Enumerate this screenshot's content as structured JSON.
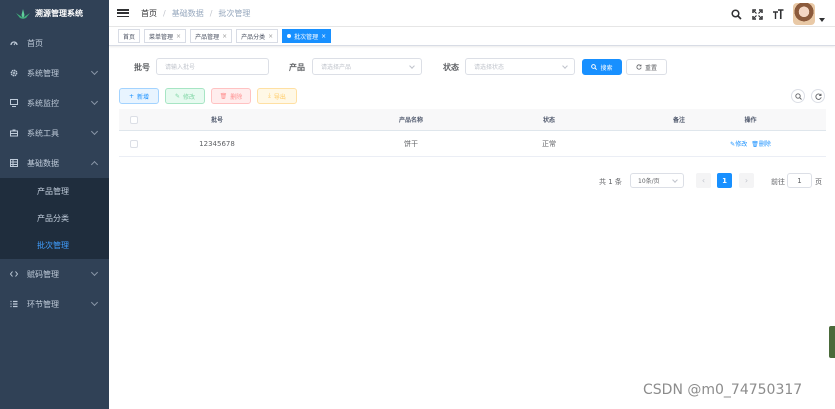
{
  "app": {
    "title": "溯源管理系统"
  },
  "sidebar": {
    "items": [
      {
        "label": "首页",
        "icon": "dashboard-icon"
      },
      {
        "label": "系统管理",
        "icon": "gear-icon"
      },
      {
        "label": "系统监控",
        "icon": "monitor-icon"
      },
      {
        "label": "系统工具",
        "icon": "toolbox-icon"
      },
      {
        "label": "基础数据",
        "icon": "table-icon"
      },
      {
        "label": "赋码管理",
        "icon": "code-icon"
      },
      {
        "label": "环节管理",
        "icon": "list-icon"
      }
    ],
    "submenu": [
      "产品管理",
      "产品分类",
      "批次管理"
    ]
  },
  "breadcrumb": {
    "home": "首页",
    "sep1": "/",
    "mid": "基础数据",
    "sep2": "/",
    "current": "批次管理"
  },
  "tags": [
    {
      "label": "首页"
    },
    {
      "label": "菜单管理",
      "x": "×"
    },
    {
      "label": "产品管理",
      "x": "×"
    },
    {
      "label": "产品分类",
      "x": "×"
    },
    {
      "label": "批次管理",
      "x": "×"
    }
  ],
  "search": {
    "batch_label": "批号",
    "batch_placeholder": "请输入批号",
    "product_label": "产品",
    "product_placeholder": "请选择产品",
    "status_label": "状态",
    "status_placeholder": "请选择状态",
    "search_button": "搜索",
    "reset_button": "重置"
  },
  "toolbar": {
    "add": "新增",
    "edit": "修改",
    "delete": "删除",
    "export": "导出"
  },
  "table": {
    "headers": [
      "批号",
      "产品名称",
      "状态",
      "备注",
      "操作"
    ],
    "rows": [
      {
        "batch": "12345678",
        "product": "饼干",
        "status": "正常",
        "remark": "",
        "edit": "修改",
        "delete": "删除"
      }
    ]
  },
  "pagination": {
    "total": "共 1 条",
    "page_size": "10条/页",
    "current_page": "1",
    "goto_label": "前往",
    "goto_value": "1",
    "goto_suffix": "页"
  },
  "watermark": "CSDN @m0_74750317",
  "colors": {
    "sidebar": "#304156",
    "primary": "#1890ff",
    "active_menu": "#409eff"
  }
}
